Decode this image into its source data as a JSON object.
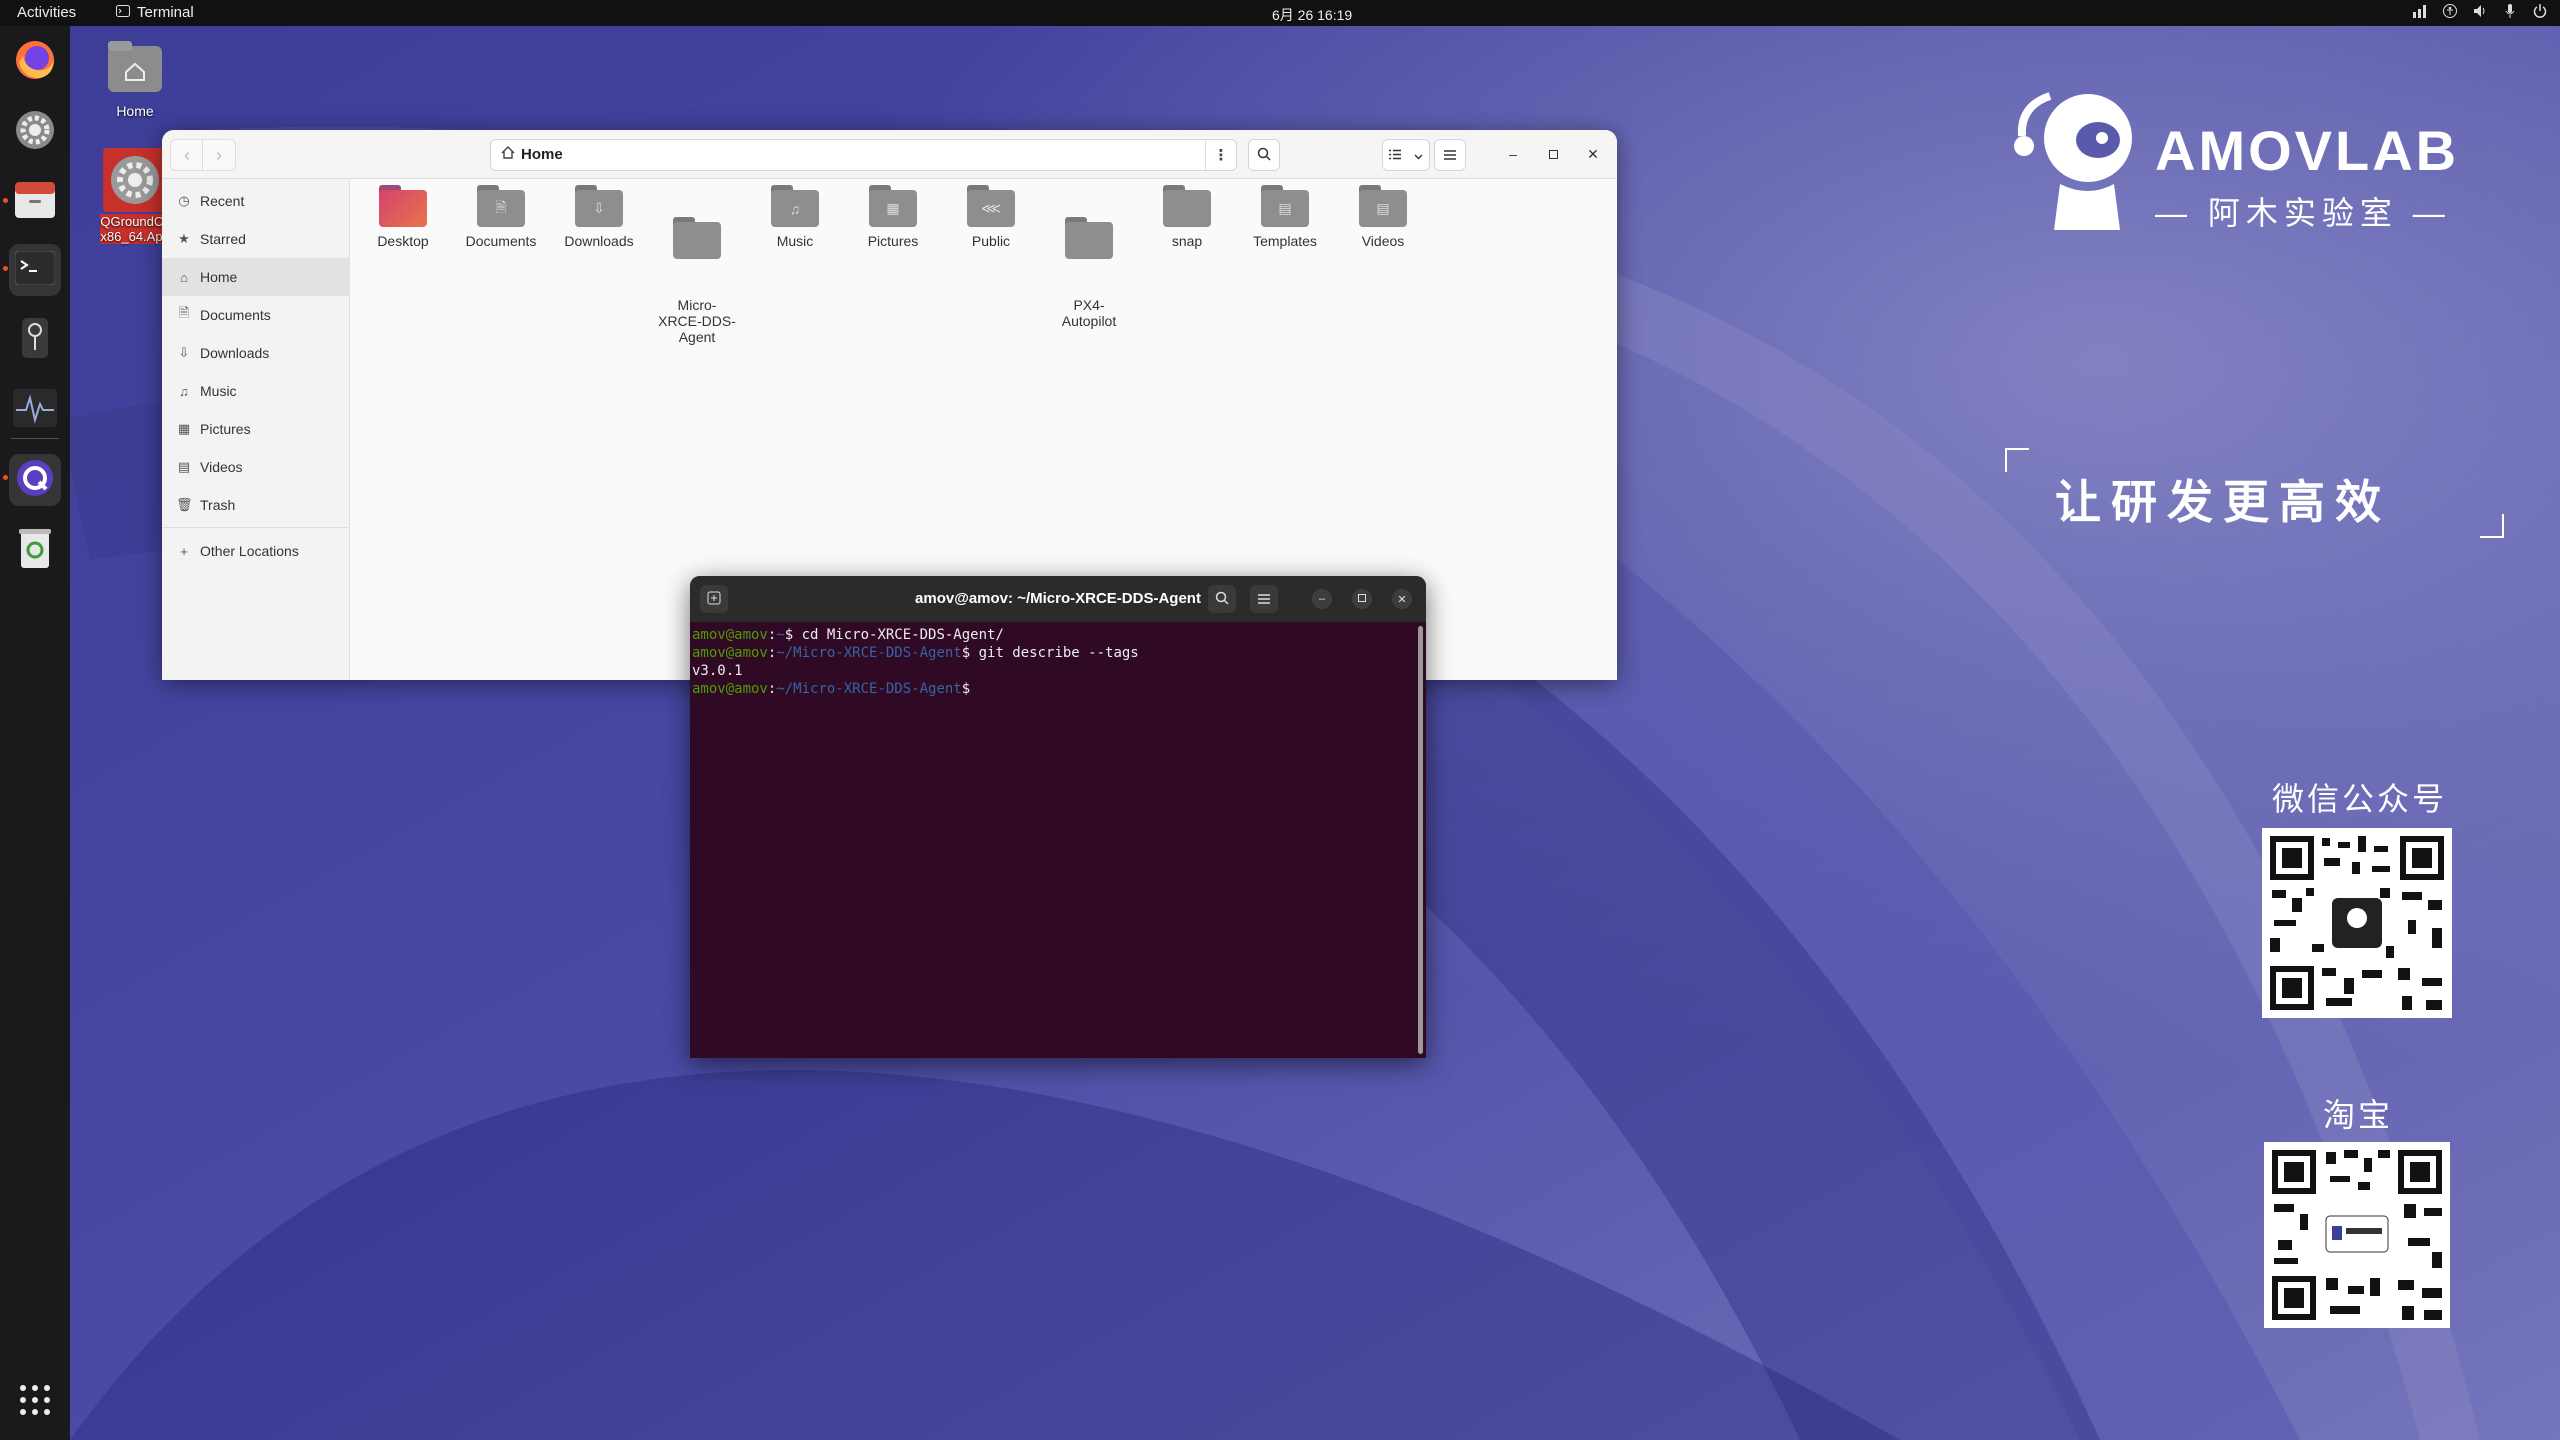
{
  "topbar": {
    "activities": "Activities",
    "app_name": "Terminal",
    "clock": "6月 26  16:19"
  },
  "desktop": {
    "icons": [
      {
        "label": "Home"
      },
      {
        "label": "QGroundCor\nx86_64.Appli"
      }
    ]
  },
  "files": {
    "path": "Home",
    "sidebar": [
      "Recent",
      "Starred",
      "Home",
      "Documents",
      "Downloads",
      "Music",
      "Pictures",
      "Videos",
      "Trash",
      "Other Locations"
    ],
    "folders": [
      "Desktop",
      "Documents",
      "Downloads",
      "Micro-\nXRCE-DDS-\nAgent",
      "Music",
      "Pictures",
      "Public",
      "PX4-\nAutopilot",
      "snap",
      "Templates",
      "Videos"
    ]
  },
  "terminal": {
    "title": "amov@amov: ~/Micro-XRCE-DDS-Agent",
    "lines": [
      {
        "user": "amov@amov",
        "dir": "~",
        "cmd": "cd Micro-XRCE-DDS-Agent/"
      },
      {
        "user": "amov@amov",
        "dir": "~/Micro-XRCE-DDS-Agent",
        "cmd": "git describe --tags"
      },
      {
        "output": "v3.0.1"
      },
      {
        "user": "amov@amov",
        "dir": "~/Micro-XRCE-DDS-Agent",
        "cmd": ""
      }
    ]
  },
  "branding": {
    "logo_text": "AMOVLAB",
    "logo_sub": "— 阿木实验室 —",
    "slogan": "让研发更高效",
    "wechat_label": "微信公众号",
    "taobao_label": "淘宝"
  },
  "colors": {
    "accent": "#e95420",
    "terminal_bg": "#300a24",
    "prompt_user": "#4e9a06",
    "prompt_dir": "#3465a4"
  }
}
